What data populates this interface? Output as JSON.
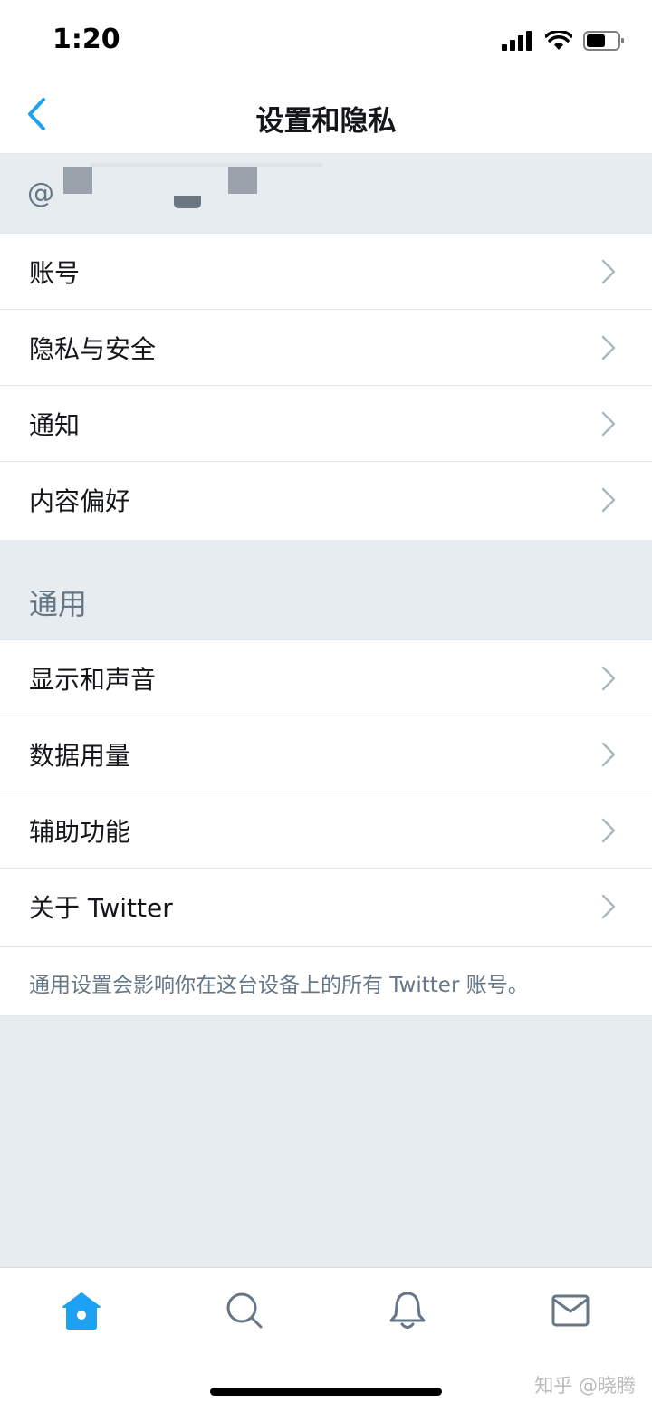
{
  "status_bar": {
    "time": "1:20"
  },
  "nav": {
    "title": "设置和隐私"
  },
  "account": {
    "handle_prefix": "@"
  },
  "rows_group1": [
    {
      "label": "账号"
    },
    {
      "label": "隐私与安全"
    },
    {
      "label": "通知"
    },
    {
      "label": "内容偏好"
    }
  ],
  "section_general": {
    "title": "通用"
  },
  "rows_group2": [
    {
      "label": "显示和声音"
    },
    {
      "label": "数据用量"
    },
    {
      "label": "辅助功能"
    },
    {
      "label": "关于 Twitter"
    }
  ],
  "footnote": "通用设置会影响你在这台设备上的所有 Twitter 账号。",
  "tabs": [
    {
      "icon": "home-icon",
      "active": true
    },
    {
      "icon": "search-icon",
      "active": false
    },
    {
      "icon": "bell-icon",
      "active": false
    },
    {
      "icon": "mail-icon",
      "active": false
    }
  ],
  "watermark": "知乎 @晓腾",
  "colors": {
    "accent": "#1da1f2",
    "icon_gray": "#657786",
    "section_bg": "#e6ecf0"
  }
}
